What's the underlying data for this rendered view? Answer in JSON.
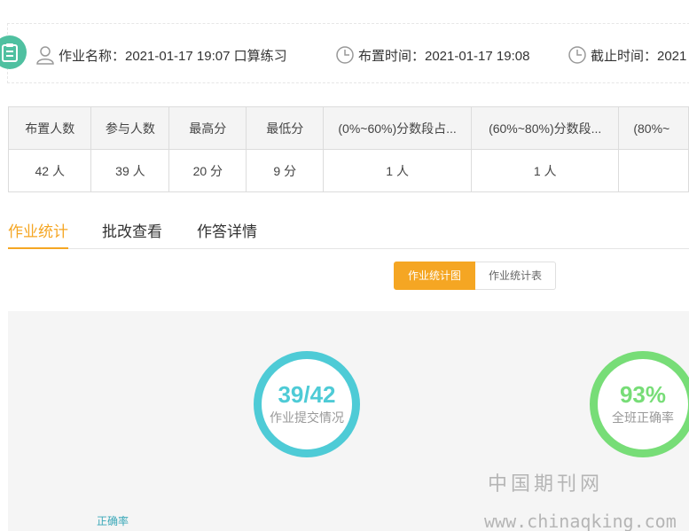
{
  "header": {
    "homework_label": "作业名称：2021-01-17 19:07 口算练习",
    "assign_time": "布置时间：2021-01-17 19:08",
    "deadline": "截止时间：2021"
  },
  "table": {
    "headers": [
      "布置人数",
      "参与人数",
      "最高分",
      "最低分",
      "(0%~60%)分数段占...",
      "(60%~80%)分数段...",
      "(80%~"
    ],
    "row": [
      "42 人",
      "39 人",
      "20 分",
      "9 分",
      "1 人",
      "1 人",
      ""
    ]
  },
  "tabs": [
    {
      "label": "作业统计"
    },
    {
      "label": "批改查看"
    },
    {
      "label": "作答详情"
    }
  ],
  "toggle": {
    "chart_label": "作业统计图",
    "table_label": "作业统计表"
  },
  "panel": {
    "submission": {
      "value": "39/42",
      "label": "作业提交情况"
    },
    "accuracy": {
      "value": "93%",
      "label": "全班正确率"
    },
    "rate_axis_label": "正确率"
  },
  "watermark": {
    "line1": "中国期刊网",
    "line2": "www.chinaqking.com"
  },
  "colors": {
    "accent": "#f5a623",
    "submission_ring": "#4ecbd6",
    "accuracy_ring": "#77dd77"
  }
}
